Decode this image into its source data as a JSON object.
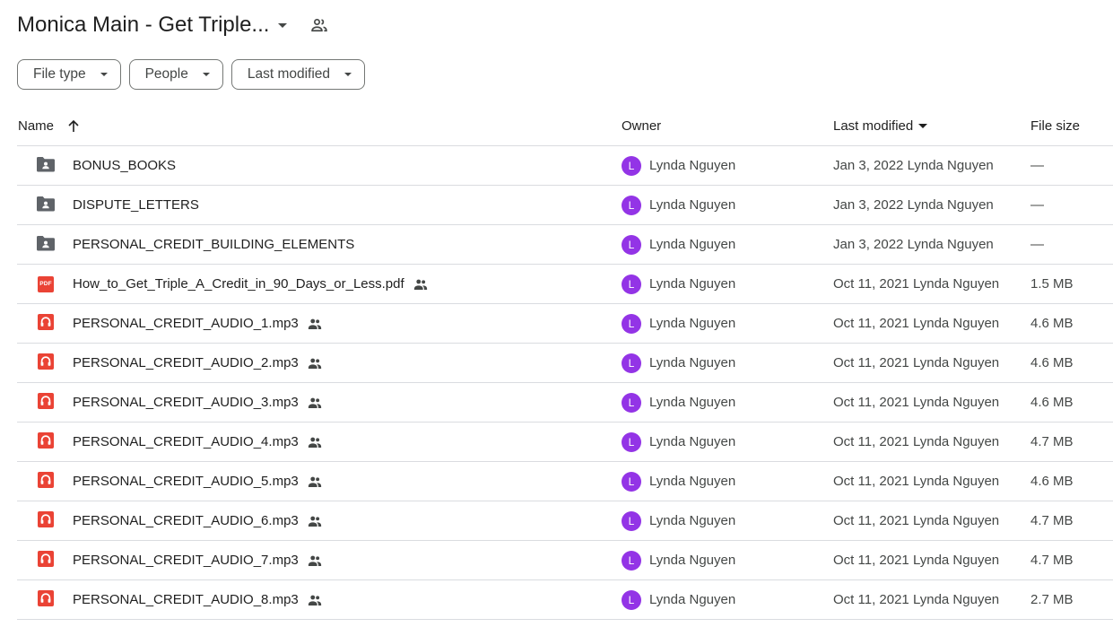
{
  "header": {
    "title": "Monica Main - Get Triple..."
  },
  "filters": [
    {
      "label": "File type"
    },
    {
      "label": "People"
    },
    {
      "label": "Last modified"
    }
  ],
  "columns": {
    "name": "Name",
    "owner": "Owner",
    "last_modified": "Last modified",
    "file_size": "File size"
  },
  "colors": {
    "avatar": "#9334e6",
    "pdf": "#ea4335",
    "folder": "#5f6368"
  },
  "rows": [
    {
      "type": "folder",
      "name": "BONUS_BOOKS",
      "shared": false,
      "owner_initial": "L",
      "owner": "Lynda Nguyen",
      "date": "Jan 3, 2022",
      "modified_by": "Lynda Nguyen",
      "size": "—"
    },
    {
      "type": "folder",
      "name": "DISPUTE_LETTERS",
      "shared": false,
      "owner_initial": "L",
      "owner": "Lynda Nguyen",
      "date": "Jan 3, 2022",
      "modified_by": "Lynda Nguyen",
      "size": "—"
    },
    {
      "type": "folder",
      "name": "PERSONAL_CREDIT_BUILDING_ELEMENTS",
      "shared": false,
      "owner_initial": "L",
      "owner": "Lynda Nguyen",
      "date": "Jan 3, 2022",
      "modified_by": "Lynda Nguyen",
      "size": "—"
    },
    {
      "type": "pdf",
      "icon_text": "PDF",
      "name": "How_to_Get_Triple_A_Credit_in_90_Days_or_Less.pdf",
      "shared": true,
      "owner_initial": "L",
      "owner": "Lynda Nguyen",
      "date": "Oct 11, 2021",
      "modified_by": "Lynda Nguyen",
      "size": "1.5 MB"
    },
    {
      "type": "audio",
      "name": "PERSONAL_CREDIT_AUDIO_1.mp3",
      "shared": true,
      "owner_initial": "L",
      "owner": "Lynda Nguyen",
      "date": "Oct 11, 2021",
      "modified_by": "Lynda Nguyen",
      "size": "4.6 MB"
    },
    {
      "type": "audio",
      "name": "PERSONAL_CREDIT_AUDIO_2.mp3",
      "shared": true,
      "owner_initial": "L",
      "owner": "Lynda Nguyen",
      "date": "Oct 11, 2021",
      "modified_by": "Lynda Nguyen",
      "size": "4.6 MB"
    },
    {
      "type": "audio",
      "name": "PERSONAL_CREDIT_AUDIO_3.mp3",
      "shared": true,
      "owner_initial": "L",
      "owner": "Lynda Nguyen",
      "date": "Oct 11, 2021",
      "modified_by": "Lynda Nguyen",
      "size": "4.6 MB"
    },
    {
      "type": "audio",
      "name": "PERSONAL_CREDIT_AUDIO_4.mp3",
      "shared": true,
      "owner_initial": "L",
      "owner": "Lynda Nguyen",
      "date": "Oct 11, 2021",
      "modified_by": "Lynda Nguyen",
      "size": "4.7 MB"
    },
    {
      "type": "audio",
      "name": "PERSONAL_CREDIT_AUDIO_5.mp3",
      "shared": true,
      "owner_initial": "L",
      "owner": "Lynda Nguyen",
      "date": "Oct 11, 2021",
      "modified_by": "Lynda Nguyen",
      "size": "4.6 MB"
    },
    {
      "type": "audio",
      "name": "PERSONAL_CREDIT_AUDIO_6.mp3",
      "shared": true,
      "owner_initial": "L",
      "owner": "Lynda Nguyen",
      "date": "Oct 11, 2021",
      "modified_by": "Lynda Nguyen",
      "size": "4.7 MB"
    },
    {
      "type": "audio",
      "name": "PERSONAL_CREDIT_AUDIO_7.mp3",
      "shared": true,
      "owner_initial": "L",
      "owner": "Lynda Nguyen",
      "date": "Oct 11, 2021",
      "modified_by": "Lynda Nguyen",
      "size": "4.7 MB"
    },
    {
      "type": "audio",
      "name": "PERSONAL_CREDIT_AUDIO_8.mp3",
      "shared": true,
      "owner_initial": "L",
      "owner": "Lynda Nguyen",
      "date": "Oct 11, 2021",
      "modified_by": "Lynda Nguyen",
      "size": "2.7 MB"
    }
  ]
}
